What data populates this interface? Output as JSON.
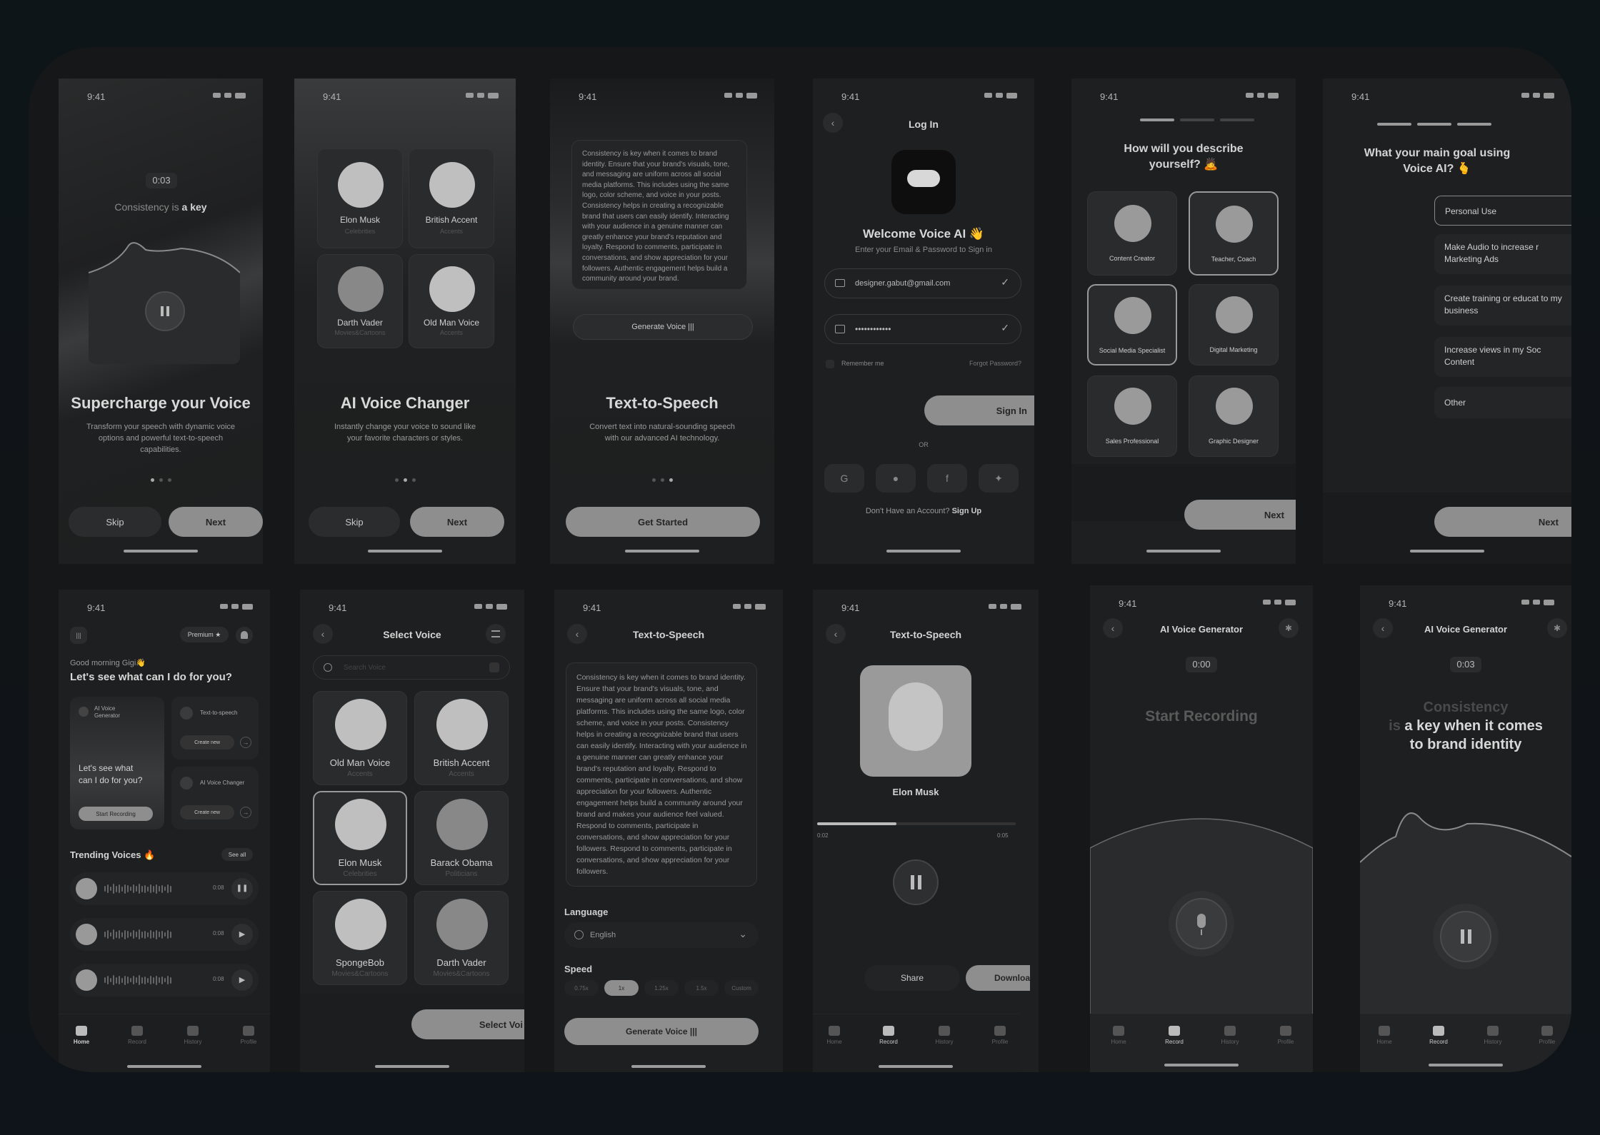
{
  "status_time": "9:41",
  "onb1": {
    "timer": "0:03",
    "caption_a": "Consistency is ",
    "caption_b": "a key",
    "title": "Supercharge your Voice",
    "desc": "Transform your speech with dynamic voice options and powerful text-to-speech capabilities.",
    "skip": "Skip",
    "next": "Next"
  },
  "onb2": {
    "voices": [
      {
        "name": "Elon Musk",
        "cat": "Celebrities"
      },
      {
        "name": "British Accent",
        "cat": "Accents"
      },
      {
        "name": "Darth Vader",
        "cat": "Movies&Cartoons"
      },
      {
        "name": "Old Man Voice",
        "cat": "Accents"
      }
    ],
    "title": "AI Voice Changer",
    "desc": "Instantly change your voice to sound like your favorite characters or styles.",
    "skip": "Skip",
    "next": "Next"
  },
  "onb3": {
    "text": "Consistency is key when it comes to brand identity. Ensure that your brand's visuals, tone, and messaging are uniform across all social media platforms. This includes using the same logo, color scheme, and voice in your posts. Consistency helps in creating a recognizable brand that users can easily identify. Interacting with your audience in a genuine manner can greatly enhance your brand's reputation and loyalty. Respond to comments, participate in conversations, and show appreciation for your followers. Authentic engagement helps build a community around your brand.",
    "generate": "Generate Voice",
    "title": "Text-to-Speech",
    "desc": "Convert text into natural-sounding speech with our advanced AI technology.",
    "cta": "Get Started"
  },
  "login": {
    "title": "Log In",
    "welcome": "Welcome Voice AI 👋",
    "sub": "Enter your Email & Password to Sign in",
    "email": "designer.gabut@gmail.com",
    "password": "••••••••••••",
    "remember": "Remember me",
    "forgot": "Forgot Password?",
    "signin": "Sign In",
    "or": "OR",
    "signup_q": "Don't Have an Account? ",
    "signup": "Sign Up"
  },
  "describe": {
    "title": "How will you describe yourself? 🙇",
    "roles": [
      "Content Creator",
      "Teacher, Coach",
      "Social Media Specialist",
      "Digital Marketing",
      "Sales Professional",
      "Graphic Designer"
    ],
    "next": "Next"
  },
  "goal": {
    "title": "What your main goal using Voice AI? 🫰",
    "options": [
      "Personal Use",
      "Make Audio to increase r Marketing Ads",
      "Create training or educat to my business",
      "Increase views in my Soc Content",
      "Other"
    ],
    "next": "Next"
  },
  "home": {
    "premium": "Premium",
    "greeting": "Good morning  Gigi👋",
    "question": "Let's see what can I do for you?",
    "c1_label": "AI Voice Generator",
    "c1_body": "Let's see what can I do for you?",
    "c1_btn": "Start Recording",
    "c2_label": "Text-to-speech",
    "c2_btn": "Create new",
    "c3_label": "AI Voice Changer",
    "c3_btn": "Create new",
    "trending": "Trending Voices 🔥",
    "see_all": "See all",
    "tracks": [
      "0:08",
      "0:08",
      "0:08"
    ],
    "nav": [
      "Home",
      "Record",
      "History",
      "Profile"
    ]
  },
  "select": {
    "title": "Select Voice",
    "search": "Search Voice",
    "voices": [
      {
        "name": "Old Man Voice",
        "cat": "Accents"
      },
      {
        "name": "British Accent",
        "cat": "Accents"
      },
      {
        "name": "Elon Musk",
        "cat": "Celebrities"
      },
      {
        "name": "Barack Obama",
        "cat": "Politicians"
      },
      {
        "name": "SpongeBob",
        "cat": "Movies&Cartoons"
      },
      {
        "name": "Darth Vader",
        "cat": "Movies&Cartoons"
      }
    ],
    "cta": "Select Voi"
  },
  "tts": {
    "title": "Text-to-Speech",
    "text": "Consistency is key when it comes to brand identity. Ensure that your brand's visuals, tone, and messaging are uniform across all social media platforms. This includes using the same logo, color scheme, and voice in your posts. Consistency helps in creating a recognizable brand that users can easily identify. Interacting with your audience in a genuine manner can greatly enhance your brand's reputation and loyalty. Respond to comments, participate in conversations, and show appreciation for your followers. Authentic engagement helps build a community around your brand and makes your audience feel valued. Respond to comments, participate in conversations, and show appreciation for your followers. Respond to comments, participate in conversations, and show appreciation for your followers.",
    "language_label": "Language",
    "language": "English",
    "speed_label": "Speed",
    "speeds": [
      "0.75x",
      "1x",
      "1.25x",
      "1.5x",
      "Custom"
    ],
    "generate": "Generate Voice"
  },
  "player": {
    "title": "Text-to-Speech",
    "name": "Elon Musk",
    "t_start": "0:02",
    "t_end": "0:05",
    "progress": 0.4,
    "share": "Share",
    "download": "Downloa",
    "nav": [
      "Home",
      "Record",
      "History",
      "Profile"
    ]
  },
  "gen1": {
    "title": "AI Voice Generator",
    "timer": "0:00",
    "prompt": "Start Recording",
    "nav": [
      "Home",
      "Record",
      "History",
      "Profile"
    ]
  },
  "gen2": {
    "title": "AI Voice Generator",
    "timer": "0:03",
    "line1": "Consistency",
    "line2a": "is ",
    "line2b": "a key  when it comes",
    "line3": "to brand identity",
    "nav": [
      "Home",
      "Record",
      "History",
      "Profile"
    ]
  }
}
